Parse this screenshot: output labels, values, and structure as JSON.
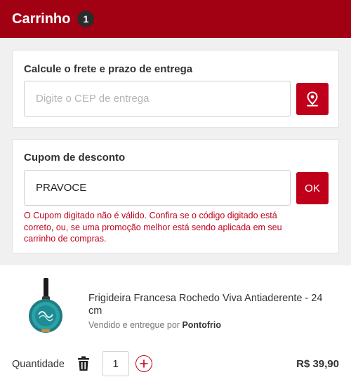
{
  "header": {
    "title": "Carrinho",
    "item_count": "1"
  },
  "freight": {
    "title": "Calcule o frete e prazo de entrega",
    "placeholder": "Digite o CEP de entrega",
    "button_icon": "location-pin-icon"
  },
  "coupon": {
    "title": "Cupom de desconto",
    "value": "PRAVOCE",
    "button_label": "OK",
    "error": "O Cupom digitado não é válido. Confira se o código digitado está correto, ou, se uma promoção melhor está sendo aplicada em seu carrinho de compras."
  },
  "product": {
    "name": "Frigideira Francesa Rochedo Viva Antiaderente - 24 cm",
    "seller_prefix": "Vendido e entregue por",
    "seller": "Pontofrio",
    "quantity_label": "Quantidade",
    "quantity": "1",
    "price": "R$ 39,90"
  },
  "colors": {
    "brand": "#a20013",
    "accent": "#c0001a",
    "badge": "#2b2b2b"
  }
}
